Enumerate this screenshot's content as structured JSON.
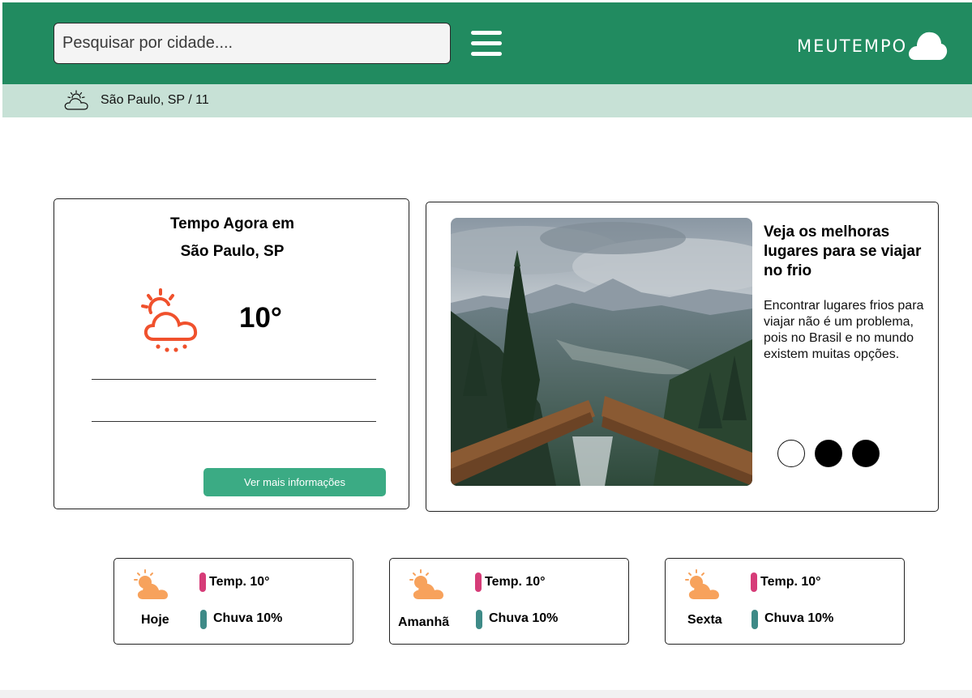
{
  "header": {
    "search_placeholder": "Pesquisar por cidade....",
    "brand": "MEUTEMPO",
    "color": "#218b60"
  },
  "location_bar": {
    "text": "São Paulo, SP / 11",
    "color": "#c7e1d6"
  },
  "now": {
    "title_line1": "Tempo Agora em",
    "title_line2": "São Paulo, SP",
    "temperature": "10°",
    "icon": "sun-cloud-rain-icon",
    "icon_color": "#f0512d",
    "more_button": "Ver mais informações",
    "button_color": "#3bab84"
  },
  "article": {
    "title": "Veja os melhoras lugares para se viajar no frio",
    "text": "Encontrar lugares frios para viajar não é um problema, pois no Brasil e no mundo existem muitas opções.",
    "carousel": {
      "pages": 3,
      "active": 1
    }
  },
  "forecast": [
    {
      "day": "Hoje",
      "temp": "Temp. 10°",
      "rain": "Chuva 10%"
    },
    {
      "day": "Amanhã",
      "temp": "Temp. 10°",
      "rain": "Chuva 10%"
    },
    {
      "day": "Sexta",
      "temp": "Temp. 10°",
      "rain": "Chuva 10%"
    }
  ],
  "forecast_colors": {
    "temp_bar": "#d63c78",
    "rain_bar": "#3e8a87",
    "icon": "#f7a25c"
  }
}
